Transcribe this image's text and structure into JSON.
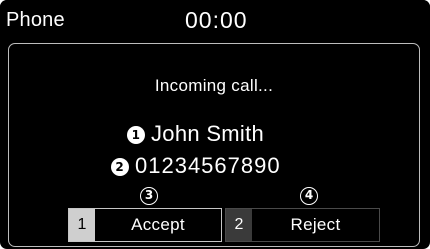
{
  "status_bar": {
    "app_title": "Phone",
    "clock": "00:00"
  },
  "call": {
    "status": "Incoming call...",
    "caller_name": "John Smith",
    "caller_number": "01234567890"
  },
  "callouts": {
    "name": "1",
    "number": "2",
    "accept": "3",
    "reject": "4"
  },
  "actions": {
    "accept": {
      "key": "1",
      "label": "Accept"
    },
    "reject": {
      "key": "2",
      "label": "Reject"
    }
  },
  "colors": {
    "background": "#000000",
    "text": "#ffffff",
    "accept_key_bg": "#cfcfcf",
    "reject_key_bg": "#3a3a3a",
    "panel_border": "#bdbdbd"
  }
}
